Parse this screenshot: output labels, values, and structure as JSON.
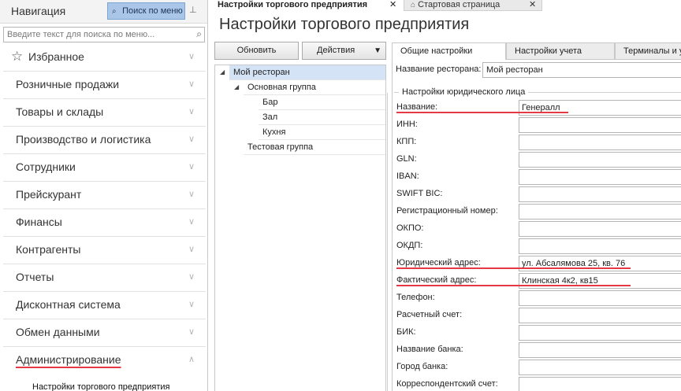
{
  "nav": {
    "title": "Навигация",
    "search_button": "Поиск по меню",
    "search_placeholder": "Введите текст для поиска по меню...",
    "items": [
      "Избранное",
      "Розничные продажи",
      "Товары и склады",
      "Производство и логистика",
      "Сотрудники",
      "Прейскурант",
      "Финансы",
      "Контрагенты",
      "Отчеты",
      "Дисконтная система",
      "Обмен данными",
      "Администрирование"
    ],
    "subitem": "Настройки торгового предприятия"
  },
  "tabs": {
    "active": "Настройки торгового предприятия",
    "home": "Стартовая страница",
    "close": "✕"
  },
  "page": {
    "title": "Настройки торгового предприятия",
    "refresh": "Обновить",
    "actions": "Действия"
  },
  "tree": [
    "Мой ресторан",
    "Основная группа",
    "Бар",
    "Зал",
    "Кухня",
    "Тестовая группа"
  ],
  "settings": {
    "tabs": [
      "Общие настройки",
      "Настройки учета",
      "Терминалы и у"
    ],
    "restaurant_label": "Название ресторана:",
    "restaurant_value": "Мой ресторан",
    "legal_title": "Настройки юридического лица",
    "fields": [
      {
        "label": "Название:",
        "value": "Генералл"
      },
      {
        "label": "ИНН:",
        "value": ""
      },
      {
        "label": "КПП:",
        "value": ""
      },
      {
        "label": "GLN:",
        "value": ""
      },
      {
        "label": "IBAN:",
        "value": ""
      },
      {
        "label": "SWIFT BIC:",
        "value": ""
      },
      {
        "label": "Регистрационный номер:",
        "value": ""
      },
      {
        "label": "ОКПО:",
        "value": ""
      },
      {
        "label": "ОКДП:",
        "value": ""
      },
      {
        "label": "Юридический адрес:",
        "value": "ул. Абсалямова 25, кв. 76"
      },
      {
        "label": "Фактический адрес:",
        "value": "Клинская 4к2, кв15"
      },
      {
        "label": "Телефон:",
        "value": ""
      },
      {
        "label": "Расчетный счет:",
        "value": ""
      },
      {
        "label": "БИК:",
        "value": ""
      },
      {
        "label": "Название банка:",
        "value": ""
      },
      {
        "label": "Город банка:",
        "value": ""
      },
      {
        "label": "Корреспондентский счет:",
        "value": ""
      }
    ]
  },
  "colors": {
    "annotation": "#e53946",
    "selection": "#d4e3f5",
    "search_button": "#a9c6e8"
  }
}
